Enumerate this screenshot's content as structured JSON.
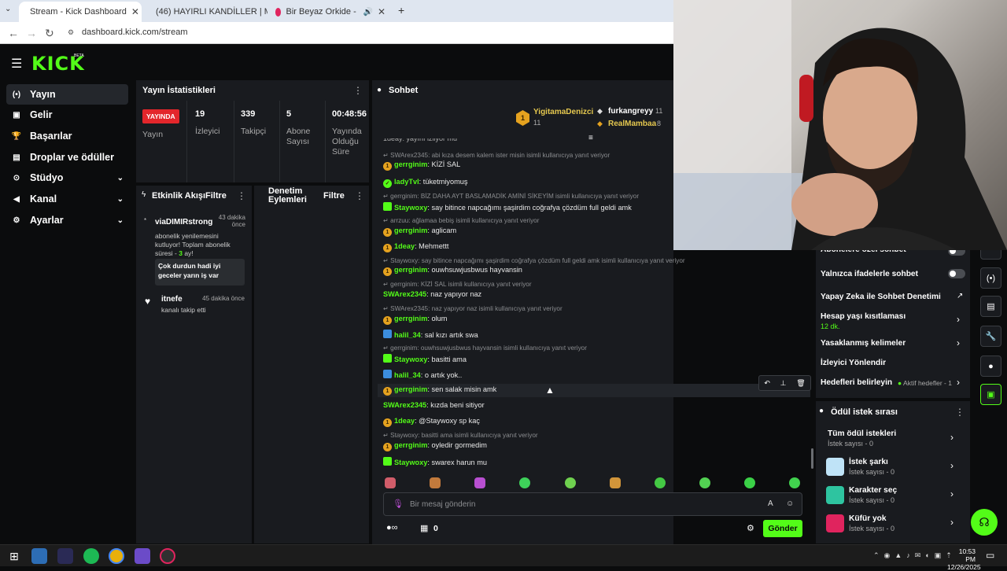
{
  "browser": {
    "tabs": [
      {
        "title": "Stream - Kick Dashboard"
      },
      {
        "title": "(46) HAYIRLI KANDİLLER | Mad..."
      },
      {
        "title": "Bir Beyaz Orkide - YouTube"
      }
    ],
    "new_tab": "+",
    "url": "dashboard.kick.com/stream"
  },
  "app": {
    "logo": "KICK",
    "beta": "BETA"
  },
  "sidebar": {
    "items": [
      {
        "label": "Yayın",
        "icon": "broadcast-icon"
      },
      {
        "label": "Gelir",
        "icon": "revenue-icon"
      },
      {
        "label": "Başarılar",
        "icon": "trophy-icon"
      },
      {
        "label": "Droplar ve ödüller",
        "icon": "gift-icon"
      },
      {
        "label": "Stüdyo",
        "icon": "studio-icon"
      },
      {
        "label": "Kanal",
        "icon": "megaphone-icon"
      },
      {
        "label": "Ayarlar",
        "icon": "gear-icon"
      }
    ]
  },
  "stats": {
    "title": "Yayın İstatistikleri",
    "live_badge": "YAYINDA",
    "live_label": "Yayın",
    "viewers": "19",
    "viewers_label": "İzleyici",
    "followers": "339",
    "followers_label": "Takipçi",
    "subs": "5",
    "subs_label1": "Abone",
    "subs_label2": "Sayısı",
    "uptime": "00:48:56",
    "uptime_label1": "Yayında",
    "uptime_label2": "Olduğu",
    "uptime_label3": "Süre"
  },
  "activity": {
    "title": "Etkinlik Akışı",
    "filter": "Filtre",
    "items": [
      {
        "user": "viaDIMIRstrong",
        "time": "43 dakika önce",
        "text1": "abonelik yenilemesini",
        "text2": "kutluyor! Toplam abonelik",
        "text3": "süresi - ",
        "months": "3",
        "text4": " ay!",
        "quote1": "Çok durdun hadi iyi",
        "quote2": "geceler yarın iş var"
      },
      {
        "user": "itnefe",
        "time": "45 dakika önce",
        "text": "kanalı takip etti"
      }
    ]
  },
  "moderation": {
    "title1": "Denetim",
    "title2": "Eylemleri",
    "filter": "Filtre"
  },
  "chat": {
    "title": "Sohbet",
    "top_gifters": [
      {
        "rank": "1",
        "name": "YigitamaDenizci",
        "count": "11"
      },
      {
        "name": "furkangreyy",
        "count": "11"
      },
      {
        "name": "RealMambaa",
        "count": "8"
      }
    ],
    "partial_top": "1deay: yayını izliyor mu",
    "messages": [
      {
        "reply": "SWArex2345: abi kıza desem kalem ister misin isimli kullanıcıya yanıt veriyor",
        "user": "gerrginim",
        "badge": "gold",
        "text": "KİZİ SAL",
        "color": "#53fc18"
      },
      {
        "user": "ladyTvl",
        "badge": "verified",
        "text": "tüketmiyomuş",
        "color": "#53fc18"
      },
      {
        "reply": "gerrginim: BİZ DAHA AYT BASLAMADİK AMİNİ SİKEYİM isimli kullanıcıya yanıt veriyor",
        "user": "Staywoxy",
        "badge": "green",
        "text": "say bitince napcağımı şaşirdim coğrafya çözdüm full geldi amk",
        "color": "#53fc18"
      },
      {
        "reply": "arrzuu: ağlamaa bebiş isimli kullanıcıya yanıt veriyor",
        "user": "gerrginim",
        "badge": "gold",
        "text": "aglicam",
        "color": "#53fc18"
      },
      {
        "user": "1deay",
        "badge": "gold",
        "text": "Mehmettt",
        "color": "#53fc18"
      },
      {
        "reply": "Staywoxy: say bitince napcağımı şaşirdim coğrafya çözdüm full geldi amk isimli kullanıcıya yanıt veriyor",
        "user": "gerrginim",
        "badge": "gold",
        "text": "ouwhsuwjusbwus hayvansin",
        "color": "#53fc18"
      },
      {
        "reply": "gerrginim: KİZİ SAL isimli kullanıcıya yanıt veriyor",
        "user": "SWArex2345",
        "badge": "",
        "text": "naz yapıyor naz",
        "color": "#53fc18"
      },
      {
        "reply": "SWArex2345: naz yapıyor naz isimli kullanıcıya yanıt veriyor",
        "user": "gerrginim",
        "badge": "gold",
        "text": "olum",
        "color": "#53fc18"
      },
      {
        "user": "halil_34",
        "badge": "blue",
        "text": "sal kızı artık swa",
        "color": "#53fc18"
      },
      {
        "reply": "gerrginim: ouwhsuwjusbwus hayvansin isimli kullanıcıya yanıt veriyor",
        "user": "Staywoxy",
        "badge": "green",
        "text": "basitti ama",
        "color": "#53fc18"
      },
      {
        "user": "halil_34",
        "badge": "blue",
        "text": "o artık yok..",
        "color": "#53fc18"
      },
      {
        "user": "gerrginim",
        "badge": "gold",
        "text": "sen salak misin amk",
        "color": "#53fc18"
      },
      {
        "user": "SWArex2345",
        "badge": "",
        "text": "kızda beni sitiyor",
        "color": "#53fc18"
      },
      {
        "user": "1deay",
        "badge": "gold",
        "text": "@Staywoxy sp kaç",
        "color": "#53fc18"
      },
      {
        "reply": "Staywoxy: basitti ama isimli kullanıcıya yanıt veriyor",
        "user": "gerrginim",
        "badge": "gold",
        "text": "oyledir gormedim",
        "color": "#53fc18"
      },
      {
        "user": "Staywoxy",
        "badge": "green",
        "text": "swarex harun mu",
        "color": "#53fc18"
      }
    ],
    "input_placeholder": "Bir mesaj gönderin",
    "points": "0",
    "send": "Gönder"
  },
  "right_panel": {
    "items": [
      {
        "label": "Abonelere özel sohbet"
      },
      {
        "label": "Yalnızca ifadelerle sohbet"
      },
      {
        "label": "Yapay Zeka ile Sohbet Denetimi"
      },
      {
        "label": "Hesap yaşı kısıtlaması",
        "sub": "12 dk."
      },
      {
        "label": "Yasaklanmış kelimeler"
      },
      {
        "label": "İzleyici Yönlendir"
      },
      {
        "label": "Hedefleri belirleyin",
        "sub": "Aktif hedefler - 1"
      }
    ],
    "rewards_title": "Ödül istek sırası",
    "rewards": [
      {
        "label": "Tüm ödül istekleri",
        "sub": "İstek sayısı - 0"
      },
      {
        "label": "İstek şarkı",
        "sub": "İstek sayısı - 0",
        "color": "#bfe3f7"
      },
      {
        "label": "Karakter seç",
        "sub": "İstek sayısı - 0",
        "color": "#2ec4a0"
      },
      {
        "label": "Küfür yok",
        "sub": "İstek sayısı - 0",
        "color": "#e0245e"
      }
    ]
  },
  "taskbar": {
    "time": "10:53 PM",
    "date": "12/26/2025"
  },
  "colors": {
    "accent": "#53fc18",
    "live": "#e3262b",
    "panel": "#191b1f",
    "bg": "#0b0c0d"
  }
}
